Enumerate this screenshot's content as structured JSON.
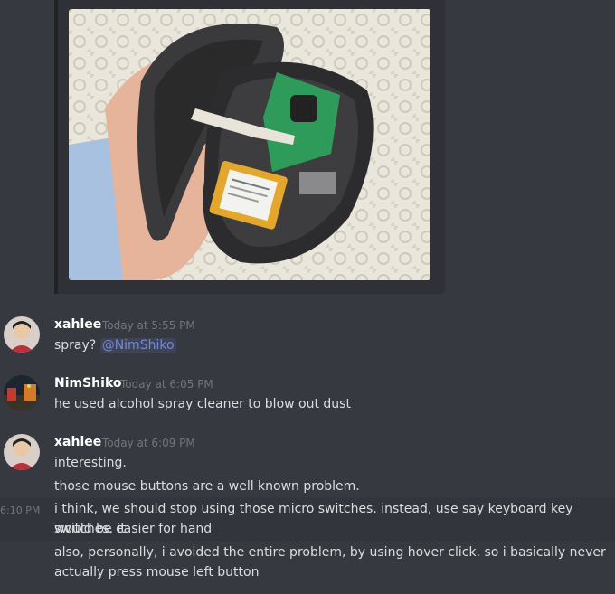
{
  "messages": [
    {
      "author": "xahlee",
      "timestamp": "Today at 5:55 PM",
      "lines": [
        "spray?"
      ],
      "mention": "@NimShiko"
    },
    {
      "author": "NimShiko",
      "timestamp": "Today at 6:05 PM",
      "lines": [
        "he used alcohol spray cleaner to blow out dust"
      ]
    },
    {
      "author": "xahlee",
      "timestamp": "Today at 6:09 PM",
      "lines": [
        "interesting.",
        "those mouse buttons are a well known problem."
      ]
    }
  ],
  "followups": [
    {
      "hover_time": "6:10 PM",
      "text1": "i think, we should stop using those micro switches. instead, use say keyboard key switches. it",
      "text2": "would be easier for hand"
    },
    {
      "text1": "also, personally, i avoided the entire problem, by using hover click. so i basically never",
      "text2": "actually press mouse left button"
    }
  ],
  "colors": {
    "background": "#36393f",
    "embed": "#2f3136",
    "mention": "#7289da",
    "username": "#ffffff",
    "timestamp": "#72767d"
  },
  "icons": {
    "embed_image": "photo-disassembled-mouse",
    "avatar_xahlee": "avatar-person",
    "avatar_nimshiko": "avatar-street-photo"
  }
}
